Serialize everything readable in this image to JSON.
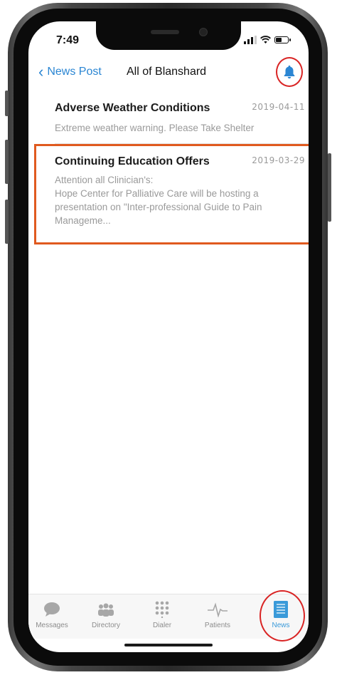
{
  "status_bar": {
    "time": "7:49",
    "signal_bars": 3,
    "battery_level": 0.45
  },
  "navbar": {
    "back_label": "News Post",
    "title": "All of Blanshard",
    "bell_icon": "bell-icon"
  },
  "news": [
    {
      "title": "Adverse Weather Conditions",
      "date": "2019-04-11",
      "body": "Extreme weather warning.  Please Take Shelter"
    },
    {
      "title": "Continuing Education Offers",
      "date": "2019-03-29",
      "body": "Attention all Clinician's:\nHope Center for Palliative Care will be hosting a presentation on \"Inter-professional Guide to Pain Manageme..."
    }
  ],
  "tabs": [
    {
      "label": "Messages",
      "icon": "chat-bubble-icon"
    },
    {
      "label": "Directory",
      "icon": "people-icon"
    },
    {
      "label": "Dialer",
      "icon": "keypad-icon"
    },
    {
      "label": "Patients",
      "icon": "heartbeat-icon"
    },
    {
      "label": "News",
      "icon": "newspaper-icon",
      "active": true
    }
  ],
  "colors": {
    "accent": "#2b86d3",
    "annotation": "#d92424",
    "highlight": "#e05a1f"
  }
}
